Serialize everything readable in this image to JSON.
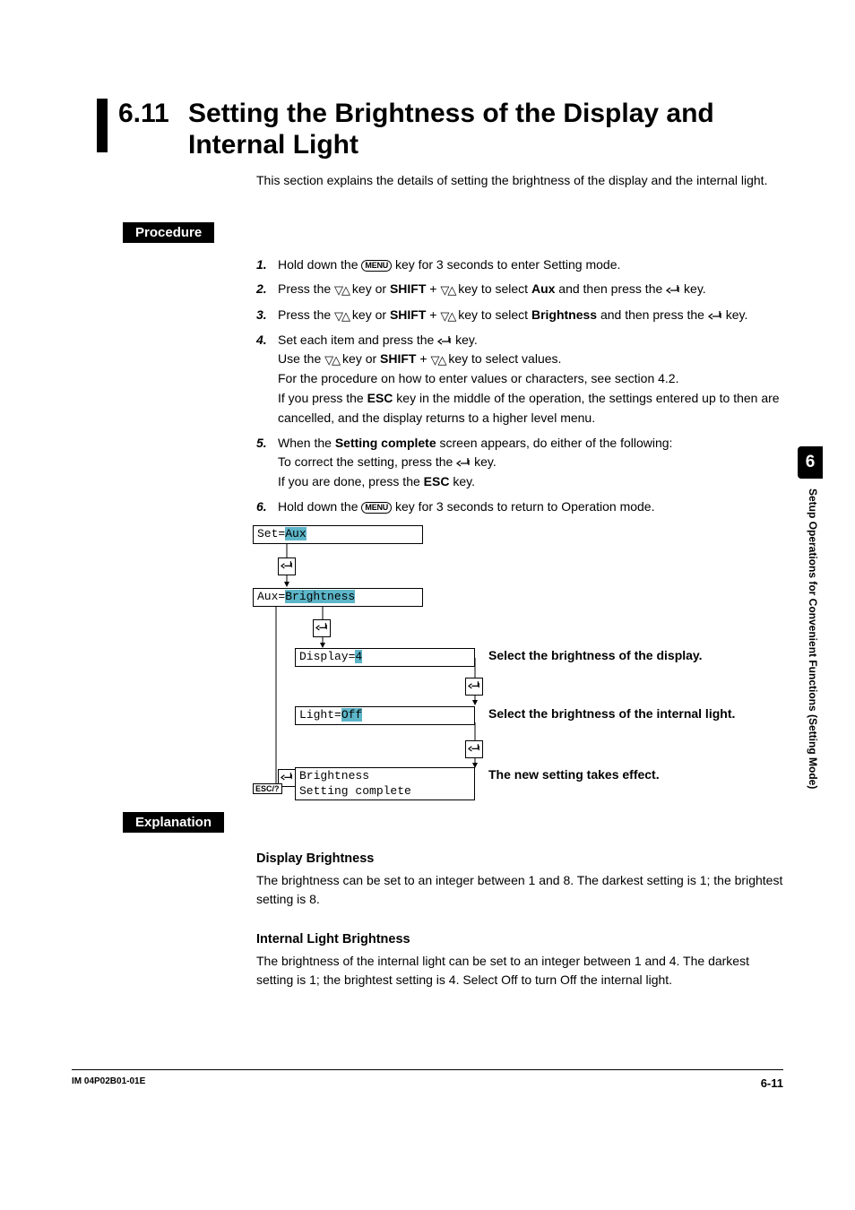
{
  "section_number": "6.11",
  "section_title": "Setting the Brightness of the Display and Internal Light",
  "intro": "This section explains the details of setting the brightness of the display and the internal light.",
  "subhead_procedure": "Procedure",
  "subhead_explanation": "Explanation",
  "menu_key": "MENU",
  "shift_key": "SHIFT",
  "esc_key": "ESC",
  "esc_small": "ESC/?",
  "steps": [
    {
      "n": "1.",
      "pre": "Hold down the ",
      "post": " key for 3 seconds to enter Setting mode."
    },
    {
      "n": "2.",
      "a": "Press the ",
      "b": " key or ",
      "c": " + ",
      "d": " key to select ",
      "sel": "Aux",
      "e": " and then press the ",
      "f": " key."
    },
    {
      "n": "3.",
      "a": "Press the ",
      "b": " key or ",
      "c": " + ",
      "d": " key to select ",
      "sel": "Brightness",
      "e": " and then press the ",
      "f": " key."
    },
    {
      "n": "4.",
      "l1a": "Set each item and press the ",
      "l1b": " key.",
      "l2a": "Use the ",
      "l2b": " key or ",
      "l2c": " + ",
      "l2d": " key to select values.",
      "l3": "For the procedure on how to enter values or characters, see section 4.2.",
      "l4a": "If you press the ",
      "l4b": " key in the middle of the operation, the settings entered up to then are cancelled, and the display returns to a higher level menu."
    },
    {
      "n": "5.",
      "l1a": "When the ",
      "sc": "Setting complete",
      "l1b": " screen appears, do either of the following:",
      "l2a": "To correct the setting, press the ",
      "l2b": " key.",
      "l3a": "If you are done, press the ",
      "l3b": " key."
    },
    {
      "n": "6.",
      "pre": "Hold down the ",
      "post": " key for 3 seconds to return to Operation mode."
    }
  ],
  "diagram": {
    "set_label": "Set=",
    "set_val": "Aux",
    "aux_label": "Aux=",
    "aux_val": "Brightness",
    "disp_label": "Display=",
    "disp_val": "4",
    "light_label": "Light=",
    "light_val": "Off",
    "final_l1": "Brightness",
    "final_l2": "Setting complete",
    "cap_display": "Select the brightness of the display.",
    "cap_light": "Select the brightness of the internal light.",
    "cap_final": "The new setting takes effect."
  },
  "explanation": {
    "h1": "Display Brightness",
    "p1": "The brightness can be set to an integer between 1 and 8. The darkest setting is 1; the brightest setting is 8.",
    "h2": "Internal Light Brightness",
    "p2": "The brightness of the internal light can be set to an integer between 1 and 4. The darkest setting is 1; the brightest setting is 4. Select Off to turn Off the internal light."
  },
  "side_tab": "6",
  "side_text": "Setup Operations for Convenient Functions (Setting Mode)",
  "footer_left": "IM 04P02B01-01E",
  "footer_right": "6-11"
}
